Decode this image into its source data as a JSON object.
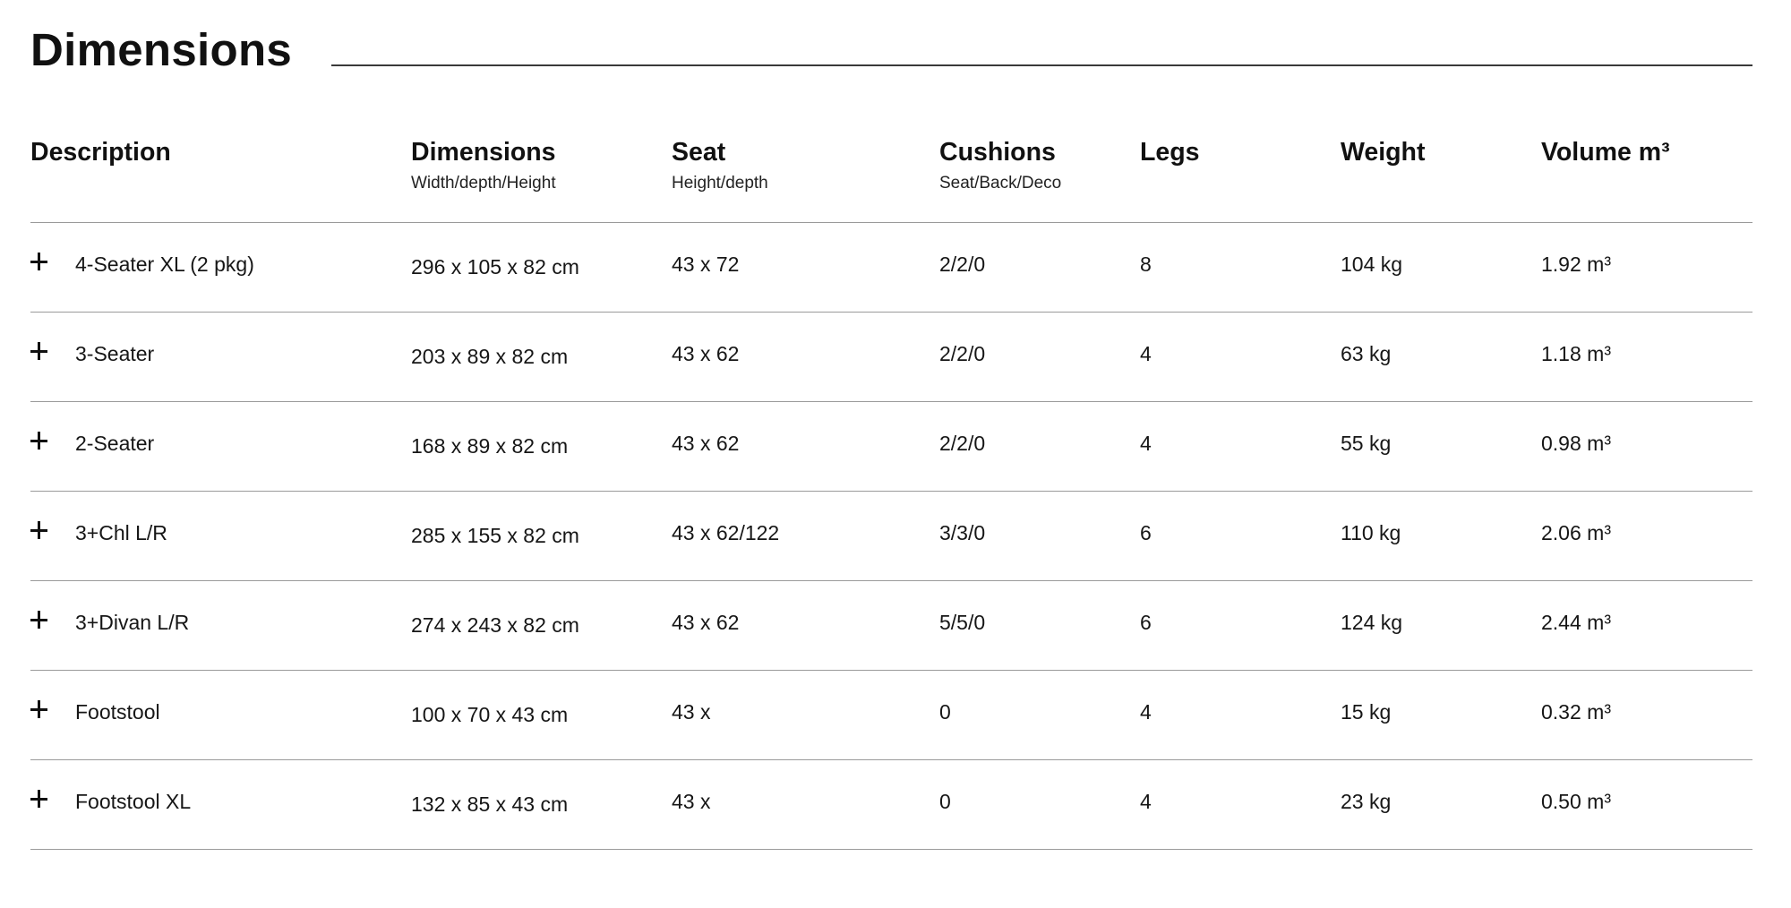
{
  "title": "Dimensions",
  "columns": [
    {
      "label": "Description",
      "sub": ""
    },
    {
      "label": "Dimensions",
      "sub": "Width/depth/Height"
    },
    {
      "label": "Seat",
      "sub": "Height/depth"
    },
    {
      "label": "Cushions",
      "sub": "Seat/Back/Deco"
    },
    {
      "label": "Legs",
      "sub": ""
    },
    {
      "label": "Weight",
      "sub": ""
    },
    {
      "label": "Volume m³",
      "sub": ""
    }
  ],
  "icons": {
    "expand": "plus-icon"
  },
  "rows": [
    {
      "description": "4-Seater XL (2 pkg)",
      "dimensions": "296 x 105 x 82 cm",
      "seat": "43 x 72",
      "cushions": "2/2/0",
      "legs": "8",
      "weight": "104 kg",
      "volume": "1.92 m³"
    },
    {
      "description": "3-Seater",
      "dimensions": "203 x 89 x 82 cm",
      "seat": "43 x 62",
      "cushions": "2/2/0",
      "legs": "4",
      "weight": "63 kg",
      "volume": "1.18 m³"
    },
    {
      "description": "2-Seater",
      "dimensions": "168 x 89 x 82 cm",
      "seat": "43 x 62",
      "cushions": "2/2/0",
      "legs": "4",
      "weight": "55 kg",
      "volume": "0.98 m³"
    },
    {
      "description": "3+Chl L/R",
      "dimensions": "285 x 155 x 82 cm",
      "seat": "43 x 62/122",
      "cushions": "3/3/0",
      "legs": "6",
      "weight": "110 kg",
      "volume": "2.06 m³"
    },
    {
      "description": "3+Divan L/R",
      "dimensions": "274 x 243 x 82 cm",
      "seat": "43 x 62",
      "cushions": "5/5/0",
      "legs": "6",
      "weight": "124 kg",
      "volume": "2.44 m³"
    },
    {
      "description": "Footstool",
      "dimensions": "100 x 70 x 43 cm",
      "seat": "43 x",
      "cushions": "0",
      "legs": "4",
      "weight": "15 kg",
      "volume": "0.32 m³"
    },
    {
      "description": "Footstool XL",
      "dimensions": "132 x 85 x 43 cm",
      "seat": "43 x",
      "cushions": "0",
      "legs": "4",
      "weight": "23 kg",
      "volume": "0.50 m³"
    }
  ]
}
